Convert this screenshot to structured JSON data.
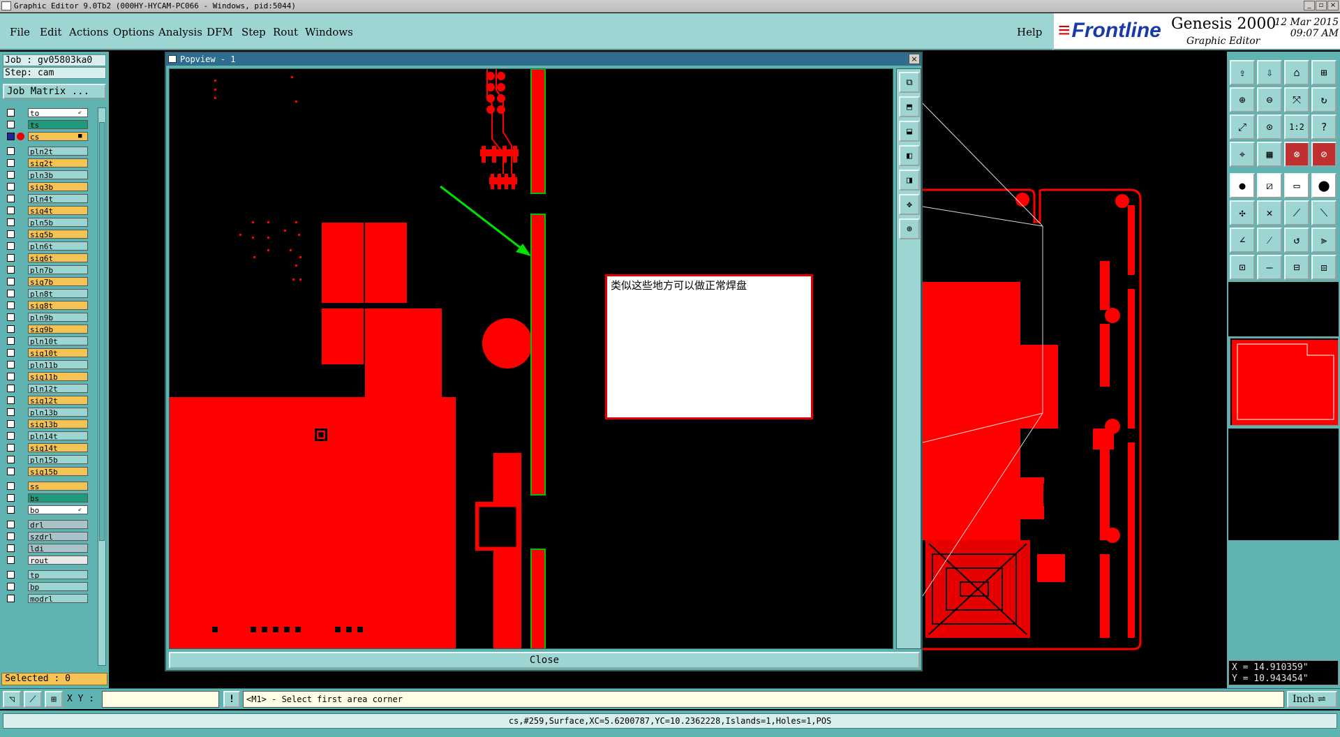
{
  "window": {
    "title": "Graphic Editor 9.0Tb2 (000HY-HYCAM-PC066 - Windows, pid:5044)",
    "controls": [
      "_",
      "▫",
      "×"
    ]
  },
  "menu": {
    "items": [
      "File",
      "Edit",
      "Actions",
      "Options",
      "Analysis",
      "DFM",
      "Step",
      "Rout",
      "Windows"
    ],
    "help": "Help"
  },
  "brand": {
    "logo": "Frontline",
    "product": "Genesis 2000",
    "subtitle": "Graphic Editor",
    "date": "12 Mar 2015",
    "time": "09:07 AM"
  },
  "job": {
    "job_label": "Job : gv05803ka0",
    "step_label": "Step: cam",
    "matrix_button": "Job Matrix ..."
  },
  "layers": [
    {
      "name": "to",
      "color": "#ffffff",
      "mark": "⇙"
    },
    {
      "name": "ts",
      "color": "#1f9a7a"
    },
    {
      "name": "cs",
      "color": "#f5c354",
      "active": true,
      "mark": "■"
    },
    {
      "name": "pln2t",
      "color": "#9dd5d3"
    },
    {
      "name": "sig2t",
      "color": "#f5c354"
    },
    {
      "name": "pln3b",
      "color": "#9dd5d3"
    },
    {
      "name": "sig3b",
      "color": "#f5c354"
    },
    {
      "name": "pln4t",
      "color": "#9dd5d3"
    },
    {
      "name": "sig4t",
      "color": "#f5c354"
    },
    {
      "name": "pln5b",
      "color": "#9dd5d3"
    },
    {
      "name": "sig5b",
      "color": "#f5c354"
    },
    {
      "name": "pln6t",
      "color": "#9dd5d3"
    },
    {
      "name": "sig6t",
      "color": "#f5c354"
    },
    {
      "name": "pln7b",
      "color": "#9dd5d3"
    },
    {
      "name": "sig7b",
      "color": "#f5c354"
    },
    {
      "name": "pln8t",
      "color": "#9dd5d3"
    },
    {
      "name": "sig8t",
      "color": "#f5c354"
    },
    {
      "name": "pln9b",
      "color": "#9dd5d3"
    },
    {
      "name": "sig9b",
      "color": "#f5c354"
    },
    {
      "name": "pln10t",
      "color": "#9dd5d3"
    },
    {
      "name": "sig10t",
      "color": "#f5c354"
    },
    {
      "name": "pln11b",
      "color": "#9dd5d3"
    },
    {
      "name": "sig11b",
      "color": "#f5c354"
    },
    {
      "name": "pln12t",
      "color": "#9dd5d3"
    },
    {
      "name": "sig12t",
      "color": "#f5c354"
    },
    {
      "name": "pln13b",
      "color": "#9dd5d3"
    },
    {
      "name": "sig13b",
      "color": "#f5c354"
    },
    {
      "name": "pln14t",
      "color": "#9dd5d3"
    },
    {
      "name": "sig14t",
      "color": "#f5c354"
    },
    {
      "name": "pln15b",
      "color": "#9dd5d3"
    },
    {
      "name": "sig15b",
      "color": "#f5c354"
    },
    {
      "name": "ss",
      "color": "#f5c354"
    },
    {
      "name": "bs",
      "color": "#1f9a7a"
    },
    {
      "name": "bo",
      "color": "#ffffff",
      "mark": "⇙"
    },
    {
      "name": "drl",
      "color": "#a8c4c8"
    },
    {
      "name": "szdrl",
      "color": "#a8c4c8"
    },
    {
      "name": "ldi",
      "color": "#a8c4c8"
    },
    {
      "name": "rout",
      "color": "#e8e8e8"
    },
    {
      "name": "tp",
      "color": "#9dd5d3"
    },
    {
      "name": "bp",
      "color": "#9dd5d3"
    },
    {
      "name": "modrl",
      "color": "#9dd5d3"
    }
  ],
  "selected": "Selected : 0",
  "popview": {
    "title": "Popview - 1",
    "close_label": "Close",
    "note": "类似这些地方可以做正常焊盘"
  },
  "coords": {
    "x": "X = 14.910359\"",
    "y": "Y = 10.943454\""
  },
  "command": {
    "xy_label": "X Y :",
    "xy_value": "",
    "excl": "!",
    "prompt": "<M1> - Select first area corner",
    "units": "Inch ⇌"
  },
  "status": "cs,#259,Surface,XC=5.6200787,YC=10.2362228,Islands=1,Holes=1,POS",
  "colors": {
    "copper": "#ff0000",
    "panel": "#5fb3b0",
    "menu": "#9dd5d3",
    "highlight": "#00e000",
    "layer_orange": "#f5c354"
  },
  "icons": {
    "tools": [
      "open-icon",
      "save-icon",
      "home-icon",
      "grid-icon",
      "zoom-in-icon",
      "zoom-out-icon",
      "pan-icon",
      "redo-icon",
      "fit-icon",
      "center-icon",
      "ratio-icon",
      "help-icon",
      "snap-icon",
      "display-icon",
      "measure-icon",
      "probe-icon",
      "pad-icon",
      "line-icon",
      "ruler-icon",
      "circle-icon",
      "node-icon",
      "cross-icon",
      "connect-icon",
      "arrow-icon",
      "draw-line-icon",
      "edit-line-icon",
      "rotate-icon",
      "split-icon",
      "add-pad-icon",
      "minus-icon",
      "align-icon",
      "copy-icon",
      "triangle-icon",
      "triangle-a-icon",
      "triangle-b-icon",
      "triangle-c-icon",
      "select-icon",
      "select-alt-icon",
      "select-move-icon",
      "select-path-icon"
    ],
    "popview": [
      "layers-icon",
      "top-icon",
      "bottom-icon",
      "left-icon",
      "right-icon",
      "expand-icon",
      "center-icon"
    ]
  }
}
